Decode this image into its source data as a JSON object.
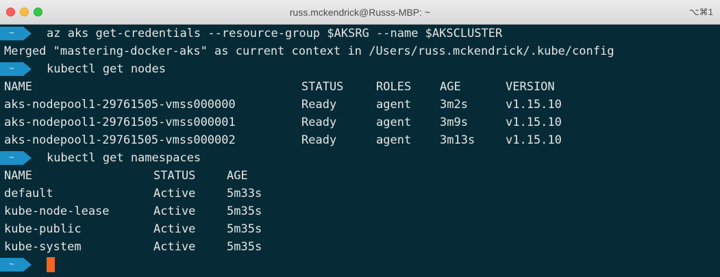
{
  "window": {
    "title": "russ.mckendrick@Russs-MBP: ~",
    "shortcut": "⌥⌘1"
  },
  "prompt_symbol": "~",
  "commands": {
    "get_credentials": "az aks get-credentials --resource-group $AKSRG --name $AKSCLUSTER",
    "get_credentials_output": "Merged \"mastering-docker-aks\" as current context in /Users/russ.mckendrick/.kube/config",
    "get_nodes": "kubectl get nodes",
    "get_namespaces": "kubectl get namespaces"
  },
  "nodes_table": {
    "headers": [
      "NAME",
      "STATUS",
      "ROLES",
      "AGE",
      "VERSION"
    ],
    "rows": [
      [
        "aks-nodepool1-29761505-vmss000000",
        "Ready",
        "agent",
        "3m2s",
        "v1.15.10"
      ],
      [
        "aks-nodepool1-29761505-vmss000001",
        "Ready",
        "agent",
        "3m9s",
        "v1.15.10"
      ],
      [
        "aks-nodepool1-29761505-vmss000002",
        "Ready",
        "agent",
        "3m13s",
        "v1.15.10"
      ]
    ]
  },
  "namespaces_table": {
    "headers": [
      "NAME",
      "STATUS",
      "AGE"
    ],
    "rows": [
      [
        "default",
        "Active",
        "5m33s"
      ],
      [
        "kube-node-lease",
        "Active",
        "5m35s"
      ],
      [
        "kube-public",
        "Active",
        "5m35s"
      ],
      [
        "kube-system",
        "Active",
        "5m35s"
      ]
    ]
  },
  "colors": {
    "background": "#062b36",
    "prompt": "#1e90c8",
    "cursor": "#f26522",
    "text": "#e6e6e6"
  }
}
